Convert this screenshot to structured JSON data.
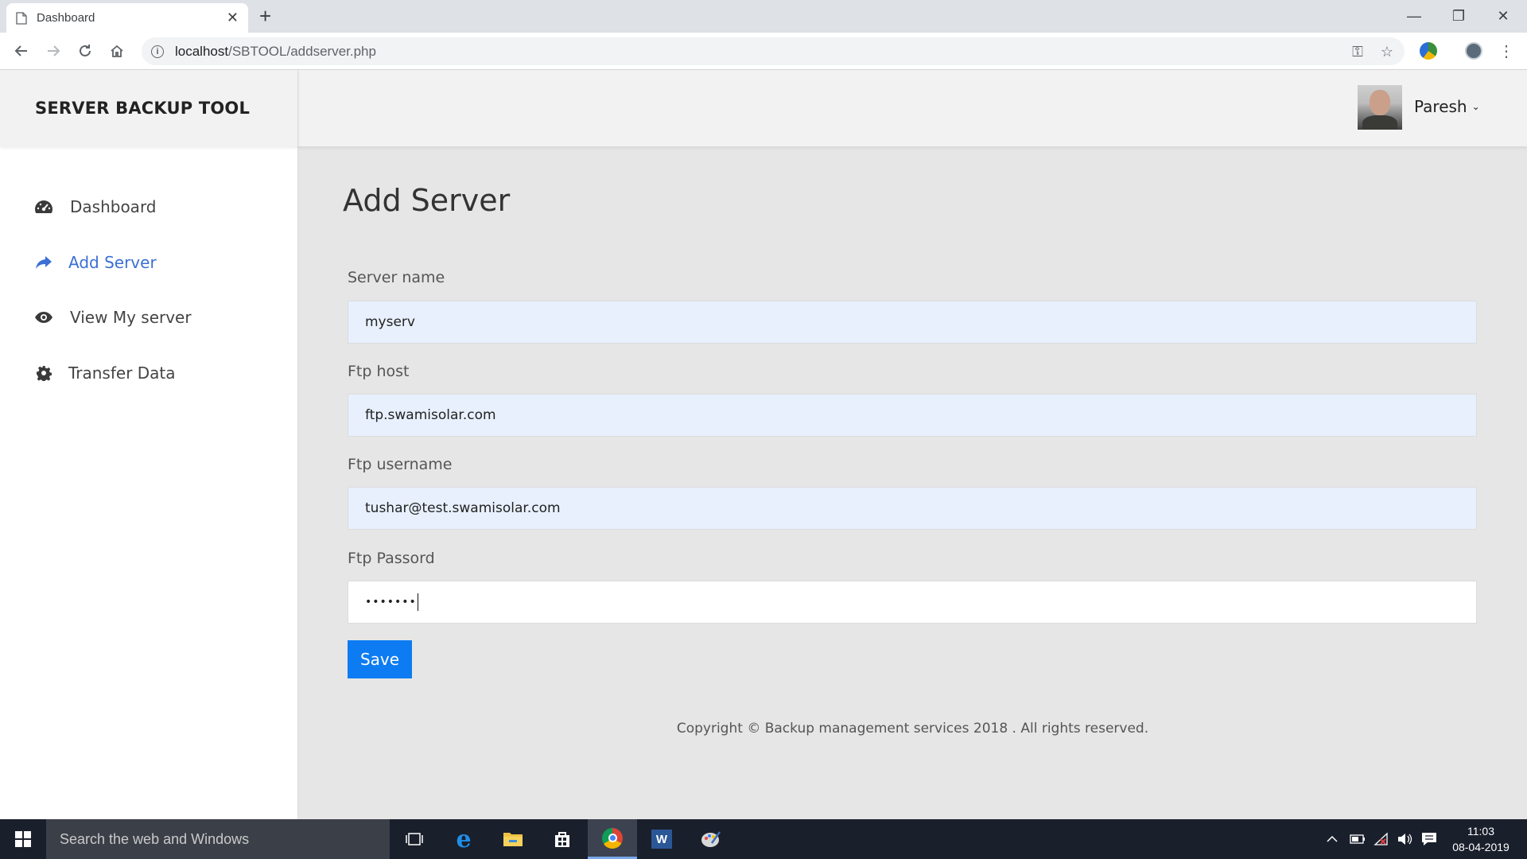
{
  "browser": {
    "tab_title": "Dashboard",
    "url_host": "localhost",
    "url_path": "/SBTOOL/addserver.php"
  },
  "app": {
    "brand": "SERVER BACKUP TOOL",
    "user_name": "Paresh"
  },
  "sidebar": {
    "items": [
      {
        "label": "Dashboard",
        "icon": "dashboard-icon"
      },
      {
        "label": "Add Server",
        "icon": "share-arrow-icon",
        "active": true
      },
      {
        "label": "View My server",
        "icon": "eye-icon"
      },
      {
        "label": "Transfer Data",
        "icon": "gear-icon"
      }
    ]
  },
  "form": {
    "title": "Add Server",
    "server_name_label": "Server name",
    "server_name_value": "myserv",
    "ftp_host_label": "Ftp host",
    "ftp_host_value": "ftp.swamisolar.com",
    "ftp_username_label": "Ftp username",
    "ftp_username_value": "tushar@test.swamisolar.com",
    "ftp_password_label": "Ftp Passord",
    "ftp_password_value": "•••••••",
    "save_label": "Save"
  },
  "footer": {
    "copyright": "Copyright © Backup management services 2018 . All rights reserved."
  },
  "taskbar": {
    "search_placeholder": "Search the web and Windows",
    "time": "11:03",
    "date": "08-04-2019"
  },
  "colors": {
    "accent": "#3b6fd4",
    "save_button": "#0d7cf2",
    "autofill_bg": "#e8f0fe"
  }
}
